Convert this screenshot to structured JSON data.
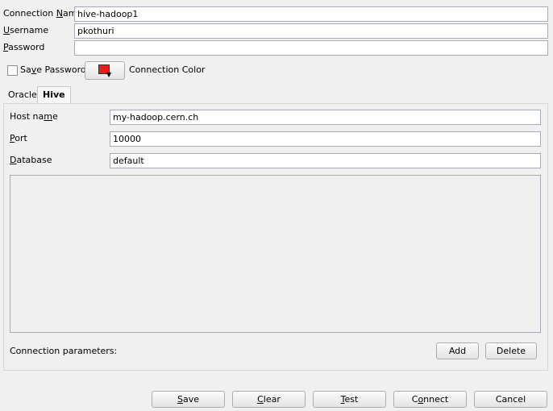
{
  "connection": {
    "name_label_prefix": "Connection ",
    "name_label_key": "N",
    "name_label_rest": "ame",
    "name_value": "hive-hadoop1",
    "username_label_key": "U",
    "username_label_rest": "sername",
    "username_value": "pkothuri",
    "password_label_key": "P",
    "password_label_rest": "assword",
    "password_value": "",
    "save_password_prefix": "Sa",
    "save_password_key": "v",
    "save_password_rest": "e Password",
    "save_password_checked": false,
    "color_label": "Connection Color",
    "color_swatch": "#e81d1d"
  },
  "tabs": [
    {
      "label": "Oracle",
      "active": false
    },
    {
      "label": "Hive",
      "active": true
    }
  ],
  "hive": {
    "host_label_prefix": "Host na",
    "host_label_key": "m",
    "host_label_rest": "e",
    "host_value": "my-hadoop.cern.ch",
    "port_label_key": "P",
    "port_label_rest": "ort",
    "port_value": "10000",
    "database_label_key": "D",
    "database_label_rest": "atabase",
    "database_value": "default",
    "params_label": "Connection parameters:",
    "add_label": "Add",
    "delete_label": "Delete"
  },
  "footer": {
    "save_key": "S",
    "save_rest": "ave",
    "clear_key": "C",
    "clear_rest": "lear",
    "test_key": "T",
    "test_rest": "est",
    "connect_prefix": "C",
    "connect_key": "o",
    "connect_rest": "nnect",
    "cancel_label": "Cancel"
  }
}
